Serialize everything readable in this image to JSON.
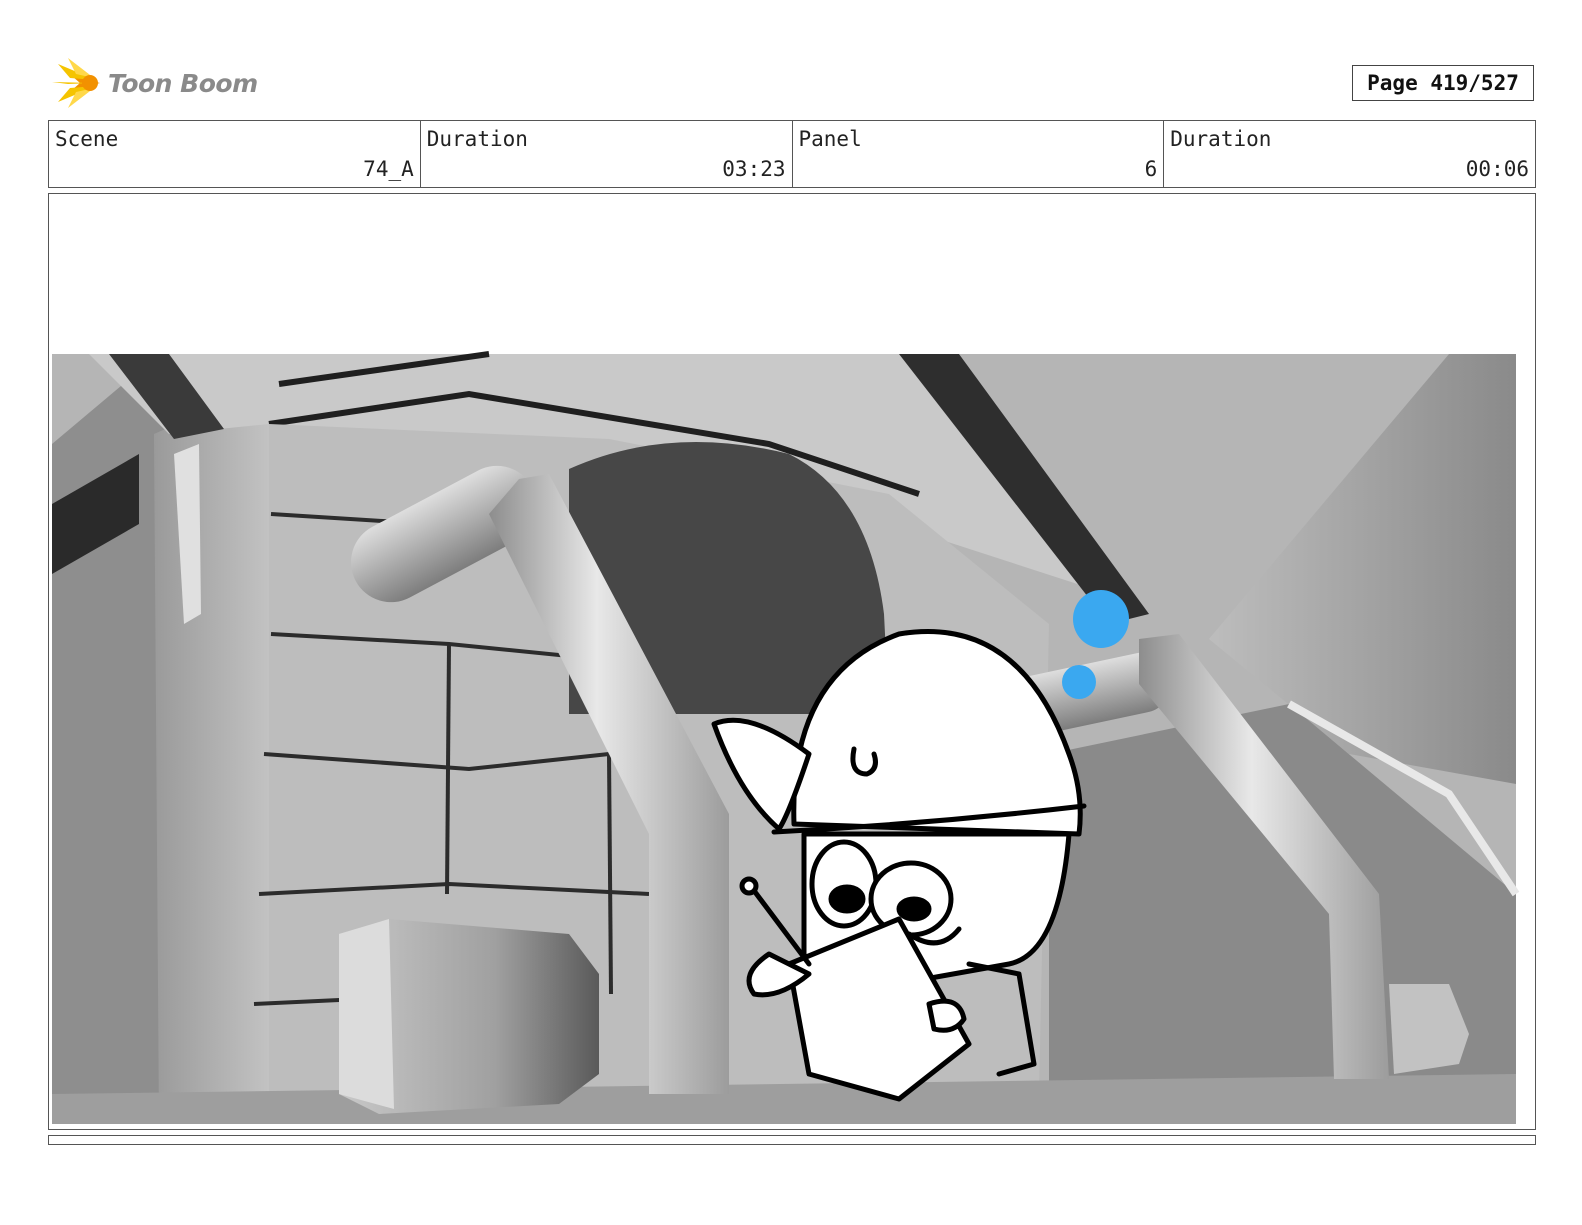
{
  "header": {
    "brand": "Toon Boom",
    "page_label": "Page 419/527"
  },
  "info": {
    "scene_label": "Scene",
    "scene_value": "74_A",
    "scene_duration_label": "Duration",
    "scene_duration_value": "03:23",
    "panel_label": "Panel",
    "panel_value": "6",
    "panel_duration_label": "Duration",
    "panel_duration_value": "00:06"
  },
  "colors": {
    "logo_yellow": "#f5c400",
    "logo_orange": "#f29100",
    "marker_blue": "#3aa8f0"
  }
}
